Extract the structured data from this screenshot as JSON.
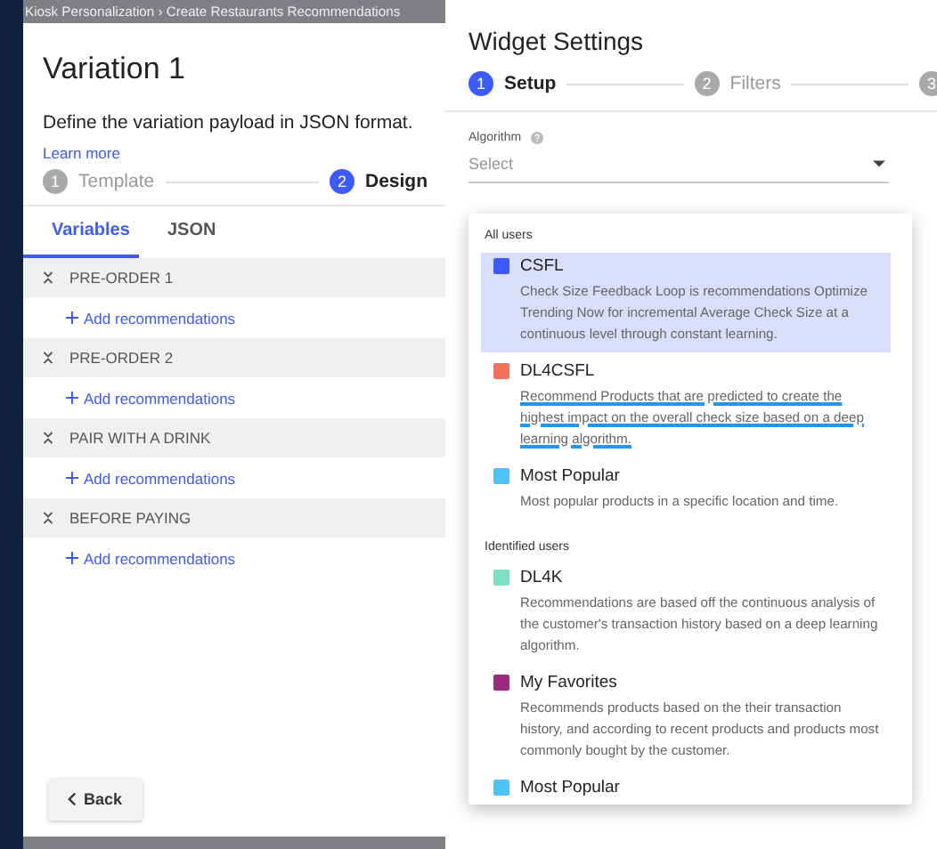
{
  "breadcrumb": "Kiosk Personalization  ›  Create Restaurants Recommendations",
  "variation": {
    "title": "Variation 1",
    "description": "Define the variation payload in JSON format.",
    "learn_more": "Learn more",
    "steps": [
      {
        "number": "1",
        "label": "Template",
        "selected": false
      },
      {
        "number": "2",
        "label": "Design",
        "selected": true
      }
    ],
    "tabs": [
      {
        "label": "Variables",
        "selected": true
      },
      {
        "label": "JSON",
        "selected": false
      }
    ],
    "sections": [
      {
        "name": "PRE-ORDER 1",
        "action": "Add recommendations"
      },
      {
        "name": "PRE-ORDER 2",
        "action": "Add recommendations"
      },
      {
        "name": "PAIR WITH A DRINK",
        "action": "Add recommendations"
      },
      {
        "name": "BEFORE PAYING",
        "action": "Add recommendations"
      }
    ],
    "back_button": "Back"
  },
  "widget_settings": {
    "title": "Widget Settings",
    "steps": [
      {
        "number": "1",
        "label": "Setup",
        "selected": true
      },
      {
        "number": "2",
        "label": "Filters",
        "selected": false
      },
      {
        "number": "3",
        "selected": false
      }
    ],
    "algorithm": {
      "label": "Algorithm",
      "placeholder": "Select"
    },
    "groups": [
      {
        "heading": "All users",
        "options": [
          {
            "name": "CSFL",
            "color": "#3d5afe",
            "selected": true,
            "description": "Check Size Feedback Loop is recommendations Optimize Trending Now for incremental Average Check Size at a continuous level through constant learning."
          },
          {
            "name": "DL4CSFL",
            "color": "#f4715e",
            "selected": false,
            "marked": true,
            "description": "Recommend Products that are predicted to create the highest impact on the overall check size based on a deep learning algorithm."
          },
          {
            "name": "Most Popular",
            "color": "#4fc3f7",
            "selected": false,
            "description": "Most popular products in a specific location and time."
          }
        ]
      },
      {
        "heading": "Identified users",
        "options": [
          {
            "name": "DL4K",
            "color": "#7ddfc3",
            "selected": false,
            "description": "Recommendations are based off the continuous analysis of the customer's transaction history based on a deep learning algorithm."
          },
          {
            "name": "My Favorites",
            "color": "#9c2a7c",
            "selected": false,
            "description": "Recommends products based on the their transaction history, and according to recent products and products most commonly bought by the customer."
          },
          {
            "name": "Most Popular",
            "color": "#4fc3f7",
            "selected": false
          }
        ]
      }
    ]
  }
}
